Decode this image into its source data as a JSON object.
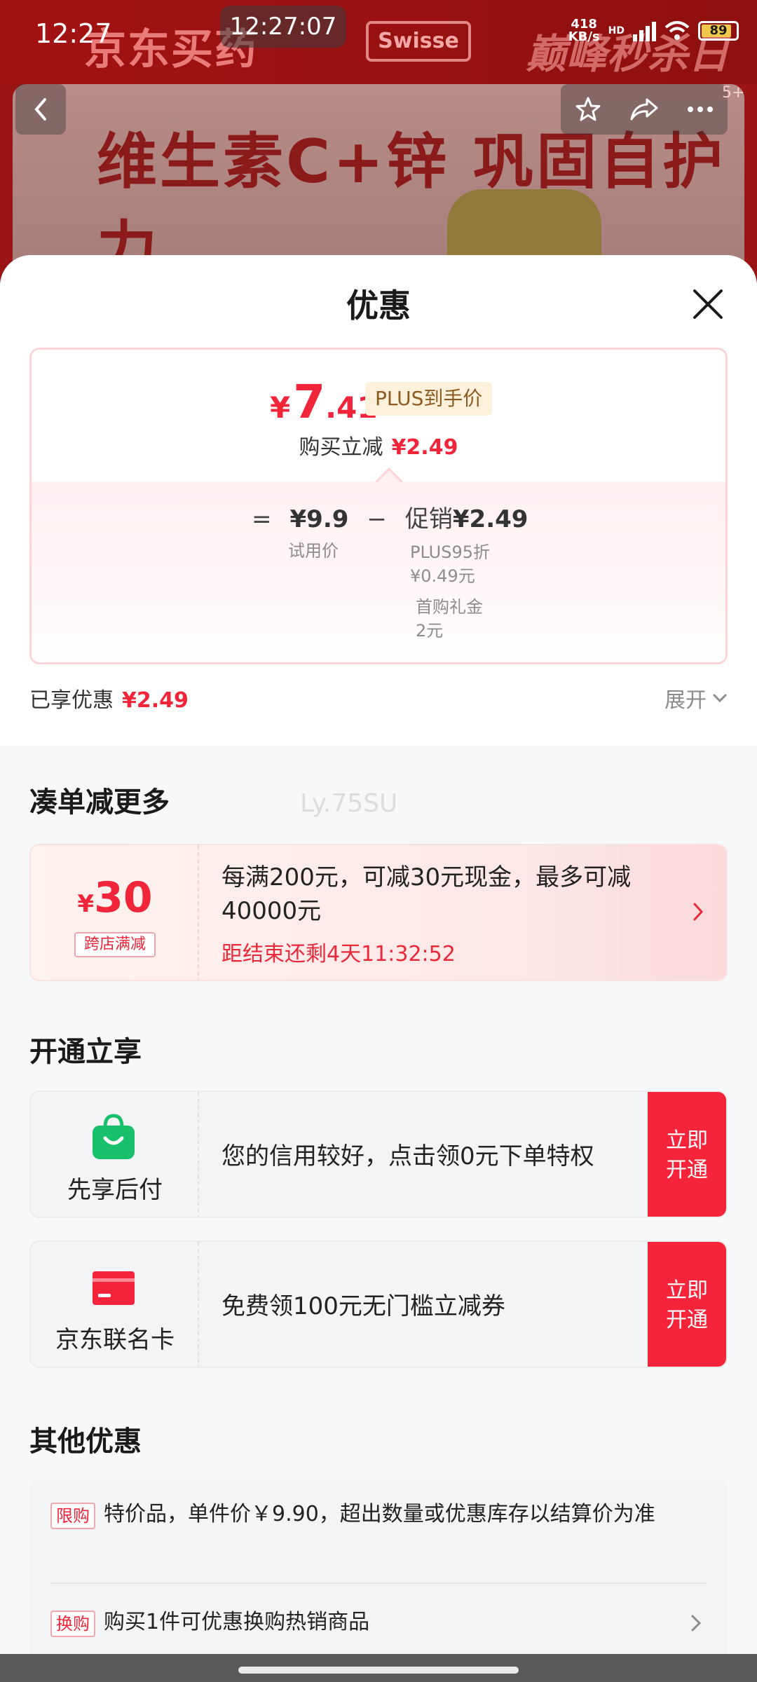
{
  "status_bar": {
    "time": "12:27",
    "center_time": "12:27:07",
    "net_speed_value": "418",
    "net_speed_unit": "KB/s",
    "hd": "HD",
    "battery": "89"
  },
  "background": {
    "brand": "京东买药",
    "partner": "Swisse",
    "slogan": "巅峰秒杀日",
    "headline": "维生素C+锌 巩固自护力",
    "badge": "5+"
  },
  "sheet": {
    "title": "优惠",
    "final_price": {
      "yen": "¥",
      "integer": "7",
      "decimal": ".41"
    },
    "plus_tag": "PLUS到手价",
    "instant_label": "购买立减",
    "instant_amount": "¥2.49",
    "formula": {
      "eq": "=",
      "trial_price": "¥9.9",
      "minus": "−",
      "promo_label": "促销",
      "promo_amount": "¥2.49",
      "trial_label": "试用价",
      "plus_discount": "PLUS95折",
      "plus_discount_amount": "¥0.49元",
      "first_gift": "首购礼金",
      "first_gift_amount": "2元"
    },
    "enjoyed_label": "已享优惠",
    "enjoyed_amount": "¥2.49",
    "expand_label": "展开"
  },
  "more": {
    "title": "凑单减更多",
    "watermark": "Ly.75SU",
    "amount_yen": "¥",
    "amount": "30",
    "tag": "跨店满减",
    "desc": "每满200元，可减30元现金，最多可减40000元",
    "countdown": "距结束还剩4天11:32:52"
  },
  "open": {
    "title": "开通立享",
    "items": [
      {
        "name": "先享后付",
        "desc": "您的信用较好，点击领0元下单特权",
        "btn_line1": "立即",
        "btn_line2": "开通"
      },
      {
        "name": "京东联名卡",
        "desc": "免费领100元无门槛立减券",
        "btn_line1": "立即",
        "btn_line2": "开通"
      }
    ]
  },
  "other": {
    "title": "其他优惠",
    "items": [
      {
        "badge": "限购",
        "text": "特价品，单件价￥9.90，超出数量或优惠库存以结算价为准"
      },
      {
        "badge": "换购",
        "text": "购买1件可优惠换购热销商品"
      }
    ]
  },
  "colors": {
    "accent": "#f0253a",
    "green": "#19c06b",
    "background_red": "#9c1515"
  }
}
